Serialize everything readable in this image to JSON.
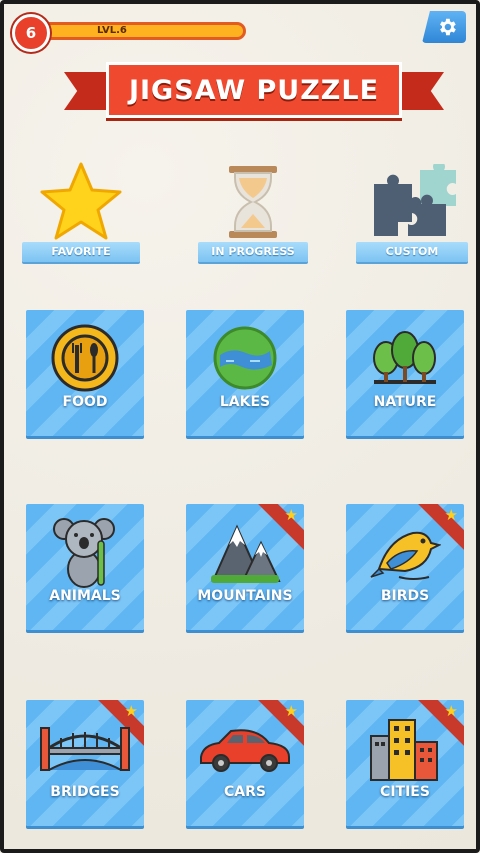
{
  "header": {
    "level_number": "6",
    "level_text": "LVL.6",
    "settings_icon": "gear-icon"
  },
  "title": "JIGSAW PUZZLE",
  "shortcuts": [
    {
      "label": "FAVORITE",
      "icon": "star-icon"
    },
    {
      "label": "IN PROGRESS",
      "icon": "hourglass-icon"
    },
    {
      "label": "CUSTOM",
      "icon": "puzzle-pieces-icon"
    }
  ],
  "categories": [
    {
      "label": "FOOD",
      "icon": "plate-cutlery-icon",
      "premium": false
    },
    {
      "label": "LAKES",
      "icon": "lake-icon",
      "premium": false
    },
    {
      "label": "NATURE",
      "icon": "trees-icon",
      "premium": false
    },
    {
      "label": "ANIMALS",
      "icon": "koala-icon",
      "premium": false
    },
    {
      "label": "MOUNTAINS",
      "icon": "mountains-icon",
      "premium": true
    },
    {
      "label": "BIRDS",
      "icon": "bird-icon",
      "premium": true
    },
    {
      "label": "BRIDGES",
      "icon": "bridge-icon",
      "premium": true
    },
    {
      "label": "CARS",
      "icon": "car-icon",
      "premium": true
    },
    {
      "label": "CITIES",
      "icon": "city-icon",
      "premium": true
    }
  ],
  "colors": {
    "accent_red": "#ef4a2f",
    "tile_blue": "#5fb6f2",
    "level_bar": "#ffb21f",
    "star_yellow": "#ffcf1f"
  }
}
